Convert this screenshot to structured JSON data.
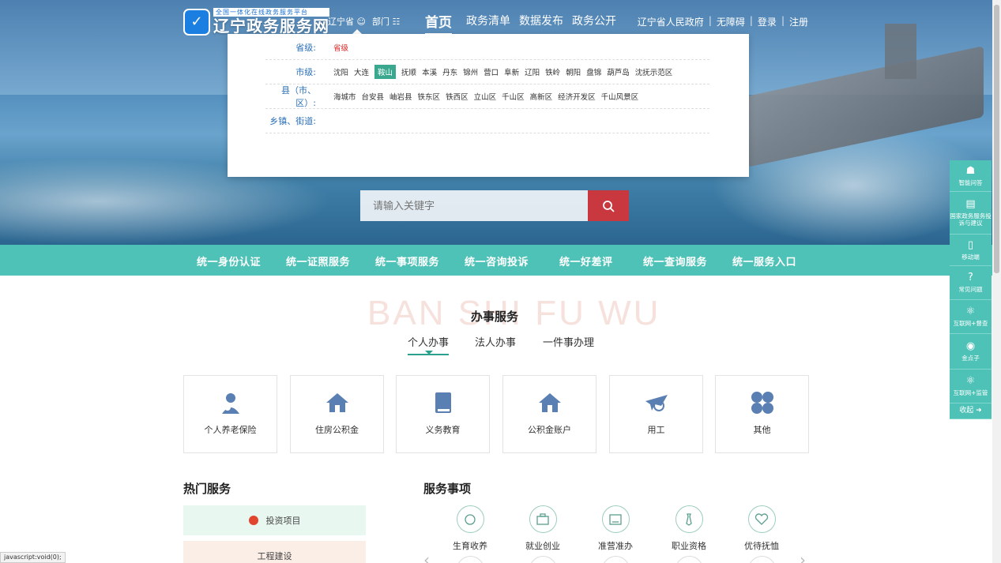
{
  "header": {
    "logo_small": "全国一体化在线政务服务平台",
    "logo_big": "辽宁政务服务网",
    "region": "辽宁省",
    "dept": "部门",
    "nav": [
      "首页",
      "政务清单",
      "数据发布",
      "政务公开"
    ],
    "right_links": [
      "辽宁省人民政府",
      "无障碍",
      "登录",
      "注册"
    ]
  },
  "dropdown": {
    "province_label": "省级:",
    "province_value": "省级",
    "city_label": "市级:",
    "cities": [
      "沈阳",
      "大连",
      "鞍山",
      "抚顺",
      "本溪",
      "丹东",
      "锦州",
      "营口",
      "阜新",
      "辽阳",
      "铁岭",
      "朝阳",
      "盘锦",
      "葫芦岛",
      "沈抚示范区"
    ],
    "active_city": "鞍山",
    "county_label": "县（市、区）:",
    "counties": [
      "海城市",
      "台安县",
      "岫岩县",
      "铁东区",
      "铁西区",
      "立山区",
      "千山区",
      "高新区",
      "经济开发区",
      "千山风景区"
    ],
    "town_label": "乡镇、街道:"
  },
  "search": {
    "placeholder": "请输入关键字"
  },
  "teal_bar": [
    "统一身份认证",
    "统一证照服务",
    "统一事项服务",
    "统一咨询投诉",
    "统一好差评",
    "统一查询服务",
    "统一服务入口"
  ],
  "services": {
    "bg_text": "BAN SHI FU WU",
    "title": "办事服务",
    "tabs": [
      "个人办事",
      "法人办事",
      "一件事办理"
    ],
    "cards": [
      "个人养老保险",
      "住房公积金",
      "义务教育",
      "公积金账户",
      "用工",
      "其他"
    ]
  },
  "hot": {
    "title": "热门服务",
    "items": [
      "投资项目",
      "工程建设"
    ]
  },
  "matters": {
    "title": "服务事项",
    "items": [
      "生育收养",
      "就业创业",
      "准营准办",
      "职业资格",
      "优待抚恤"
    ]
  },
  "floatbar": [
    {
      "label": "智能问答",
      "icon": "robot-icon"
    },
    {
      "label": "国家政务服务投诉与建议",
      "icon": "message-icon"
    },
    {
      "label": "移动端",
      "icon": "phone-icon"
    },
    {
      "label": "常见问题",
      "icon": "question-icon"
    },
    {
      "label": "互联网+督查",
      "icon": "atom-icon"
    },
    {
      "label": "金点子",
      "icon": "eye-icon"
    },
    {
      "label": "互联网+监管",
      "icon": "atom-icon"
    }
  ],
  "floatbar_collapse": "收起",
  "status_text": "javascript:void(0);",
  "colors": {
    "teal": "#4fc2b7",
    "search_red": "#c8383e",
    "active_green": "#3aa88f"
  }
}
